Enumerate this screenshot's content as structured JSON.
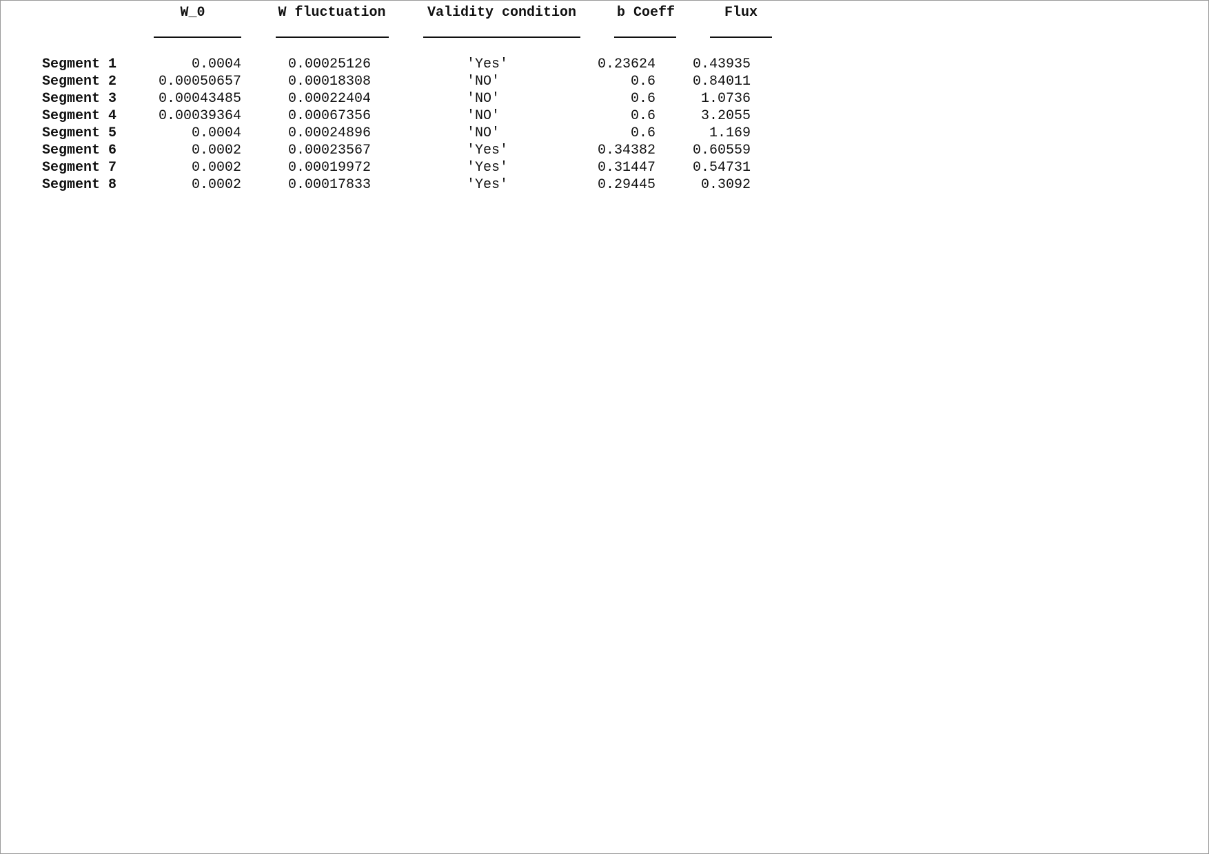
{
  "table": {
    "headers": [
      "W_0",
      "W fluctuation",
      "Validity condition",
      "b Coeff",
      "Flux"
    ],
    "rows": [
      {
        "label": "Segment 1",
        "w0": "0.0004",
        "wfluct": "0.00025126",
        "validity": "'Yes'",
        "bcoeff": "0.23624",
        "flux": "0.43935"
      },
      {
        "label": "Segment 2",
        "w0": "0.00050657",
        "wfluct": "0.00018308",
        "validity": "'NO'",
        "bcoeff": "0.6",
        "flux": "0.84011"
      },
      {
        "label": "Segment 3",
        "w0": "0.00043485",
        "wfluct": "0.00022404",
        "validity": "'NO'",
        "bcoeff": "0.6",
        "flux": "1.0736"
      },
      {
        "label": "Segment 4",
        "w0": "0.00039364",
        "wfluct": "0.00067356",
        "validity": "'NO'",
        "bcoeff": "0.6",
        "flux": "3.2055"
      },
      {
        "label": "Segment 5",
        "w0": "0.0004",
        "wfluct": "0.00024896",
        "validity": "'NO'",
        "bcoeff": "0.6",
        "flux": "1.169"
      },
      {
        "label": "Segment 6",
        "w0": "0.0002",
        "wfluct": "0.00023567",
        "validity": "'Yes'",
        "bcoeff": "0.34382",
        "flux": "0.60559"
      },
      {
        "label": "Segment 7",
        "w0": "0.0002",
        "wfluct": "0.00019972",
        "validity": "'Yes'",
        "bcoeff": "0.31447",
        "flux": "0.54731"
      },
      {
        "label": "Segment 8",
        "w0": "0.0002",
        "wfluct": "0.00017833",
        "validity": "'Yes'",
        "bcoeff": "0.29445",
        "flux": "0.3092"
      }
    ]
  }
}
